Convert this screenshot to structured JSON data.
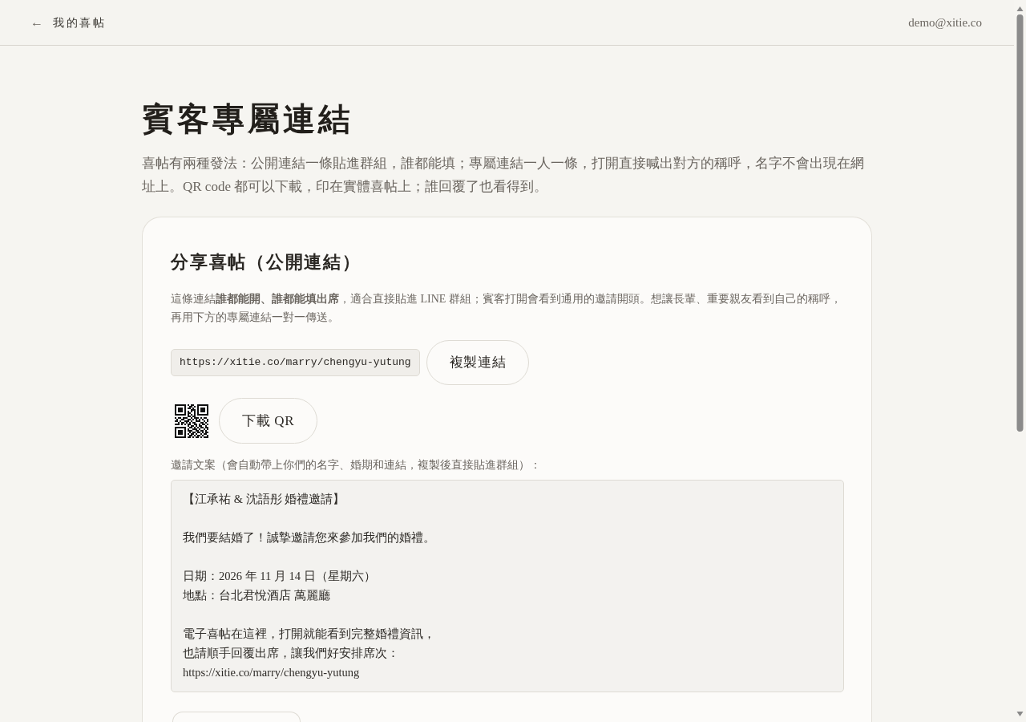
{
  "header": {
    "back_arrow": "←",
    "back_label": "我的喜帖",
    "account_email": "demo@xitie.co"
  },
  "page": {
    "title": "賓客專屬連結",
    "intro": "喜帖有兩種發法：公開連結一條貼進群組，誰都能填；專屬連結一人一條，打開直接喊出對方的稱呼，名字不會出現在網址上。QR code 都可以下載，印在實體喜帖上；誰回覆了也看得到。"
  },
  "share_card": {
    "heading": "分享喜帖（公開連結）",
    "description": "這條連結**誰都能開、誰都能填出席**，適合直接貼進 LINE 群組；賓客打開會看到通用的邀請開頭。想讓長輩、重要親友看到自己的稱呼，再用下方的專屬連結一對一傳送。",
    "link_field": {
      "value": "https://xitie.co/marry/chengyu-yutung"
    },
    "copy_button": "複製連結",
    "qr_download_button": "下載 QR",
    "invitation_label": "邀請文案（會自動帶上你們的名字、婚期和連結，複製後直接貼進群組）：",
    "invitation_text": {
      "paragraphs": [
        [
          "【江承祐 & 沈語彤 婚禮邀請】"
        ],
        [
          "我們要結婚了！誠摯邀請您來參加我們的婚禮。"
        ],
        [
          "日期：2026 年 11 月 14 日（星期六）",
          "地點：台北君悅酒店 萬麗廳"
        ],
        [
          "電子喜帖在這裡，打開就能看到完整婚禮資訊，",
          "也請順手回覆出席，讓我們好安排席次：",
          "https://xitie.co/marry/chengyu-yutung"
        ]
      ]
    }
  }
}
